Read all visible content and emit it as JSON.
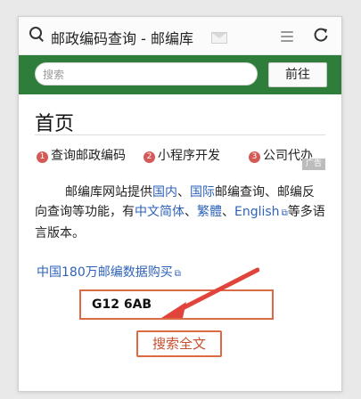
{
  "browser": {
    "title": "邮政编码查询 - 邮编库"
  },
  "search": {
    "placeholder": "搜索",
    "go_label": "前往"
  },
  "page": {
    "heading": "首页",
    "features": [
      {
        "num": "1",
        "label": "查询邮政编码"
      },
      {
        "num": "2",
        "label": "小程序开发"
      },
      {
        "num": "3",
        "label": "公司代办"
      }
    ],
    "ad_badge": "广告",
    "intro": {
      "p1": "邮编库网站提供",
      "link_domestic": "国内",
      "sep1": "、",
      "link_intl": "国际",
      "p2": "邮编查询、邮编反向查询等功能，有",
      "link_simplified": "中文简体",
      "sep2": "、",
      "link_traditional": "繁體",
      "sep3": "、",
      "link_english": "English",
      "p3": "等多语言版本。"
    },
    "buy_link": "中国180万邮编数据购买",
    "code_value": "G12 6AB",
    "search_fulltext_label": "搜索全文"
  },
  "colors": {
    "green_bar": "#2f7d3a",
    "link": "#2f63b8",
    "accent": "#dc6a45",
    "arrow": "#e0443a"
  }
}
